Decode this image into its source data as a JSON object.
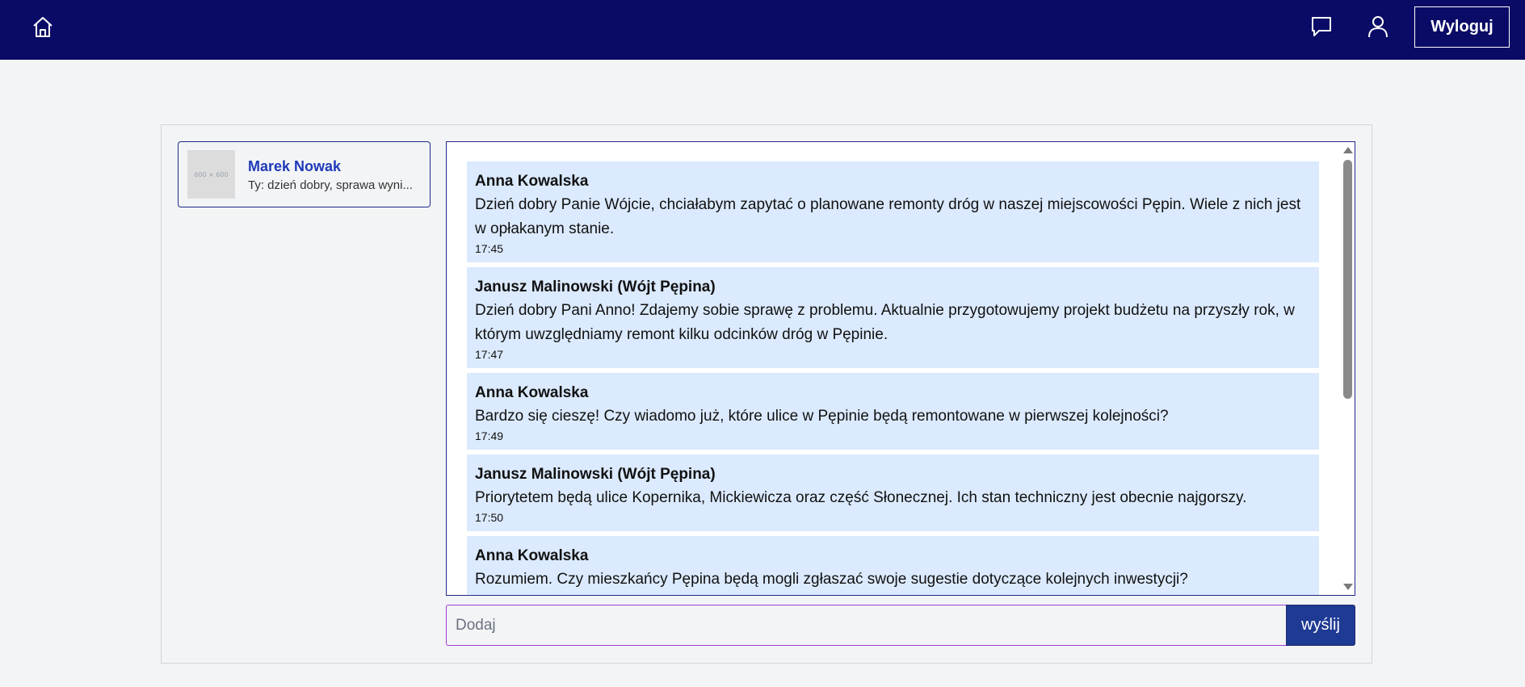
{
  "header": {
    "logout_label": "Wyloguj",
    "icons": {
      "home": "home-icon",
      "chat": "chat-icon",
      "user": "user-icon"
    }
  },
  "conversations": [
    {
      "avatar_text": "600 × 600",
      "name": "Marek Nowak",
      "preview": "Ty: dzień dobry, sprawa wyni..."
    }
  ],
  "messages": [
    {
      "author": "Anna Kowalska",
      "text": "Dzień dobry Panie Wójcie, chciałabym zapytać o planowane remonty dróg w naszej miejscowości Pępin. Wiele z nich jest w opłakanym stanie.",
      "time": "17:45"
    },
    {
      "author": "Janusz Malinowski (Wójt Pępina)",
      "text": "Dzień dobry Pani Anno! Zdajemy sobie sprawę z problemu. Aktualnie przygotowujemy projekt budżetu na przyszły rok, w którym uwzględniamy remont kilku odcinków dróg w Pępinie.",
      "time": "17:47"
    },
    {
      "author": "Anna Kowalska",
      "text": "Bardzo się cieszę! Czy wiadomo już, które ulice w Pępinie będą remontowane w pierwszej kolejności?",
      "time": "17:49"
    },
    {
      "author": "Janusz Malinowski (Wójt Pępina)",
      "text": "Priorytetem będą ulice Kopernika, Mickiewicza oraz część Słonecznej. Ich stan techniczny jest obecnie najgorszy.",
      "time": "17:50"
    },
    {
      "author": "Anna Kowalska",
      "text": "Rozumiem. Czy mieszkańcy Pępina będą mogli zgłaszać swoje sugestie dotyczące kolejnych inwestycji?",
      "time": ""
    }
  ],
  "composer": {
    "placeholder": "Dodaj",
    "value": "",
    "send_label": "wyślij"
  },
  "colors": {
    "header_bg": "#0a0b66",
    "message_bg": "#dbeafe",
    "accent": "#1e2a8a",
    "send_bg": "#1f3a93",
    "input_border": "#a53bd6"
  }
}
